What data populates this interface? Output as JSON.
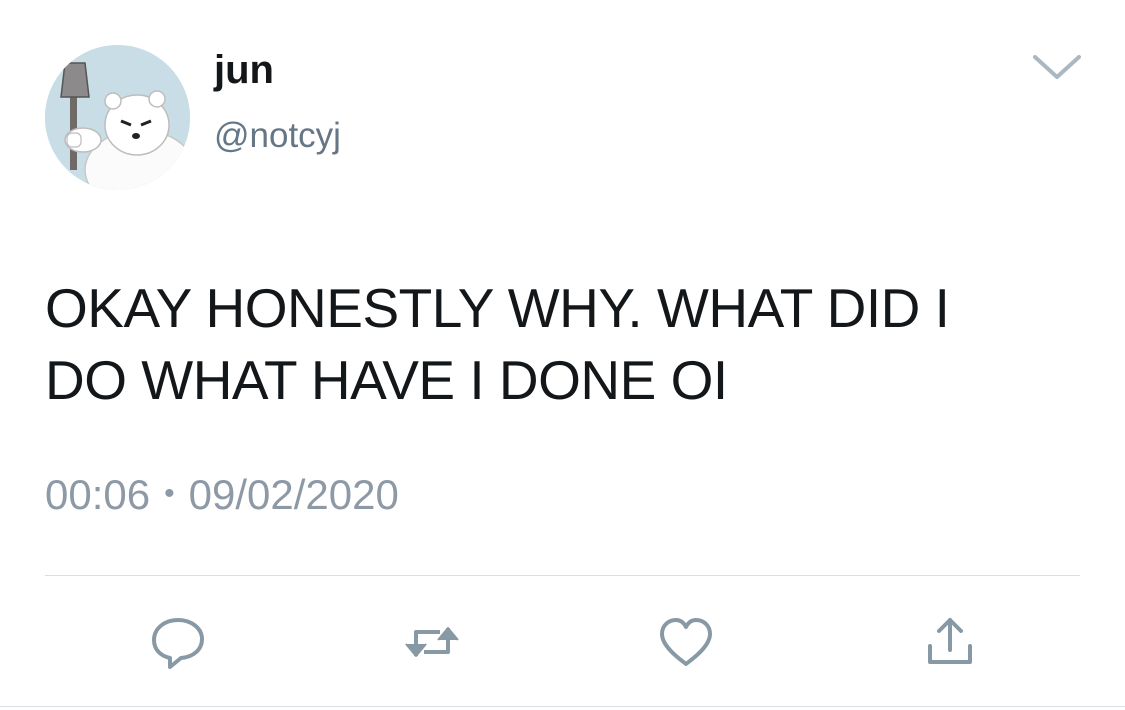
{
  "tweet": {
    "author": {
      "display_name": "jun",
      "handle": "@notcyj",
      "avatar": "polar-bear-with-axe-avatar"
    },
    "text": "OKAY HONESTLY WHY. WHAT DID I\nDO WHAT HAVE I DONE OI",
    "time": "00:06",
    "separator": "•",
    "date": "09/02/2020",
    "menu_icon": "chevron-down-icon"
  },
  "actions": {
    "icons": [
      "reply-icon",
      "retweet-icon",
      "like-icon",
      "share-icon"
    ]
  },
  "colors": {
    "text": "#14171a",
    "secondary": "#657786",
    "icon": "#8899a6",
    "divider": "#d9dee2"
  }
}
